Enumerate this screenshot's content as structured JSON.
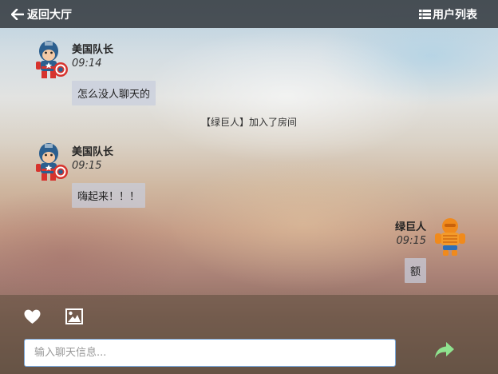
{
  "header": {
    "back_label": "返回大厅",
    "userlist_label": "用户列表"
  },
  "messages": [
    {
      "sender": "美国队长",
      "time": "09:14",
      "text": "怎么没人聊天的",
      "avatar": "captain-america-avatar"
    },
    {
      "sender": "美国队长",
      "time": "09:15",
      "text": "嗨起来！！！",
      "avatar": "captain-america-avatar"
    },
    {
      "sender": "绿巨人",
      "time": "09:15",
      "text": "额",
      "avatar": "orange-hero-avatar"
    }
  ],
  "system": {
    "join_notice": "【绿巨人】加入了房间"
  },
  "composer": {
    "placeholder": "输入聊天信息...",
    "value": ""
  },
  "colors": {
    "accent_send": "#8fe38f",
    "input_border": "#7aa7d8"
  }
}
